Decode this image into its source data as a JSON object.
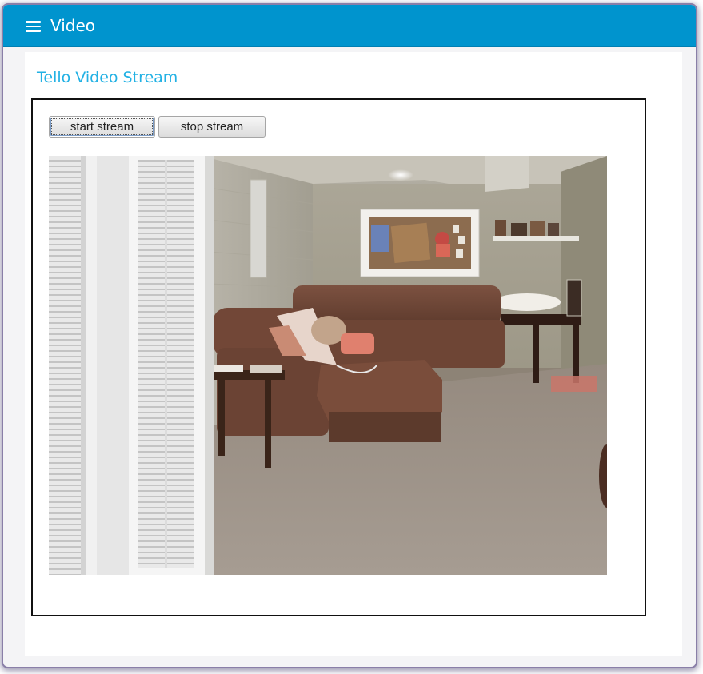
{
  "appbar": {
    "title": "Video",
    "menu_icon": "hamburger-menu-icon",
    "color": "#0094ce"
  },
  "page": {
    "title": "Tello Video Stream",
    "title_color": "#22b1e4"
  },
  "controls": {
    "start_label": "start stream",
    "stop_label": "stop stream"
  },
  "video": {
    "description_alt": "live camera frame"
  }
}
